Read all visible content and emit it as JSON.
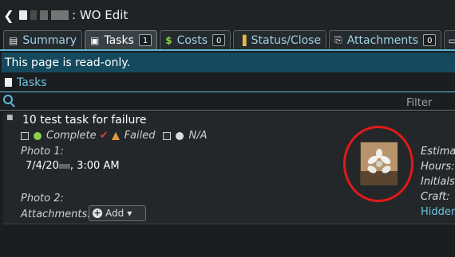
{
  "titlebar": {
    "title": ": WO Edit"
  },
  "tabs": [
    {
      "label": "Summary",
      "icon": "document-icon",
      "badge": ""
    },
    {
      "label": "Tasks",
      "icon": "clipboard-icon",
      "badge": "1"
    },
    {
      "label": "Costs",
      "icon": "dollar-icon",
      "badge": "0"
    },
    {
      "label": "Status/Close",
      "icon": "traffic-light-icon",
      "badge": ""
    },
    {
      "label": "Attachments",
      "icon": "paperclip-icon",
      "badge": "0"
    }
  ],
  "banner": {
    "text": "This page is read-only."
  },
  "section": {
    "title": "Tasks"
  },
  "filter": {
    "label": "Filter"
  },
  "task": {
    "title": "10  test task for failure",
    "status": {
      "complete": "Complete",
      "failed": "Failed",
      "na": "N/A"
    },
    "photo1_label": "Photo 1:",
    "photo1_date_prefix": "7/4/20",
    "photo1_date_suffix": ", 3:00 AM",
    "photo2_label": "Photo 2:",
    "attachments_label": "Attachments:",
    "add_button": "Add",
    "right": {
      "estimate": "Estima",
      "hours": "Hours:",
      "initials": "Initials:",
      "craft": "Craft:",
      "hidden": "Hidden"
    }
  },
  "colors": {
    "accent": "#59b9d6",
    "banner": "#154a5e",
    "highlight_circle": "#e01a1a",
    "failed_check": "#e23b3b"
  }
}
